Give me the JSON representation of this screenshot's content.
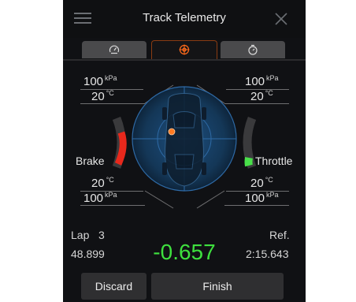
{
  "header": {
    "title": "Track Telemetry",
    "menu_icon": "hamburger-menu-icon",
    "close_icon": "close-x-icon"
  },
  "tabs": [
    {
      "icon": "speedometer-icon",
      "active": false
    },
    {
      "icon": "target-crosshair-icon",
      "active": true
    },
    {
      "icon": "stopwatch-icon",
      "active": false
    }
  ],
  "telemetry": {
    "front_left": {
      "pressure": "100",
      "pressure_unit": "kPa",
      "temp": "20",
      "temp_unit": "°C"
    },
    "front_right": {
      "pressure": "100",
      "pressure_unit": "kPa",
      "temp": "20",
      "temp_unit": "°C"
    },
    "rear_left": {
      "temp": "20",
      "temp_unit": "°C",
      "pressure": "100",
      "pressure_unit": "kPa"
    },
    "rear_right": {
      "temp": "20",
      "temp_unit": "°C",
      "pressure": "100",
      "pressure_unit": "kPa"
    },
    "brake_label": "Brake",
    "throttle_label": "Throttle",
    "brake_level": 0.5,
    "throttle_level": 0.12
  },
  "lap": {
    "label": "Lap",
    "number": "3",
    "time": "48.899",
    "delta": "-0.657",
    "ref_label": "Ref.",
    "ref_time": "2:15.643"
  },
  "buttons": {
    "discard": "Discard",
    "finish": "Finish"
  },
  "colors": {
    "accent": "#ff6a1a",
    "delta_green": "#3ee03e",
    "brake_red": "#e8281c",
    "throttle_green": "#49e04a",
    "gauge_blue": "#1f5e9a"
  }
}
